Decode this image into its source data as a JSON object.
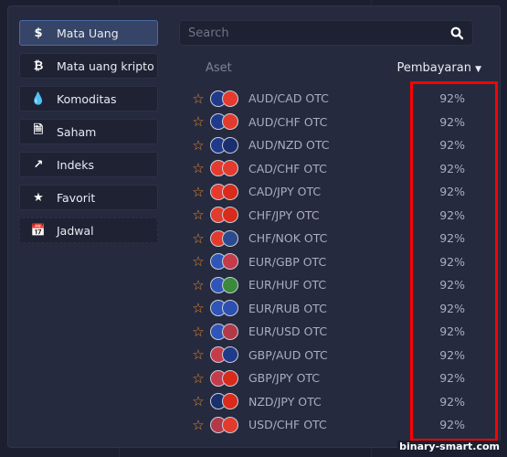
{
  "sidebar": {
    "items": [
      {
        "label": "Mata Uang",
        "icon": "dollar-icon",
        "glyph": "$",
        "active": true
      },
      {
        "label": "Mata uang kripto",
        "icon": "bitcoin-icon",
        "glyph": "₿"
      },
      {
        "label": "Komoditas",
        "icon": "drop-icon",
        "glyph": "💧"
      },
      {
        "label": "Saham",
        "icon": "document-icon",
        "glyph": "🗎"
      },
      {
        "label": "Indeks",
        "icon": "trend-up-icon",
        "glyph": "↗"
      },
      {
        "label": "Favorit",
        "icon": "star-icon",
        "glyph": "★"
      },
      {
        "label": "Jadwal",
        "icon": "calendar-icon",
        "glyph": "📅"
      }
    ]
  },
  "search": {
    "placeholder": "Search"
  },
  "header": {
    "asset": "Aset",
    "payout": "Pembayaran"
  },
  "flag_colors": {
    "AUD": "#1f3a8a",
    "CAD": "#e63a2e",
    "CHF": "#e23b2e",
    "NZD": "#1a2f6e",
    "JPY": "#d92b1c",
    "NOK": "#2c4a8e",
    "EUR": "#2f55b8",
    "GBP": "#c63b4a",
    "HUF": "#3a8a3a",
    "RUB": "#2d4fb0",
    "USD": "#b23a48"
  },
  "assets": [
    {
      "name": "AUD/CAD OTC",
      "payout": "92%"
    },
    {
      "name": "AUD/CHF OTC",
      "payout": "92%"
    },
    {
      "name": "AUD/NZD OTC",
      "payout": "92%"
    },
    {
      "name": "CAD/CHF OTC",
      "payout": "92%"
    },
    {
      "name": "CAD/JPY OTC",
      "payout": "92%"
    },
    {
      "name": "CHF/JPY OTC",
      "payout": "92%"
    },
    {
      "name": "CHF/NOK OTC",
      "payout": "92%"
    },
    {
      "name": "EUR/GBP OTC",
      "payout": "92%"
    },
    {
      "name": "EUR/HUF OTC",
      "payout": "92%"
    },
    {
      "name": "EUR/RUB OTC",
      "payout": "92%"
    },
    {
      "name": "EUR/USD OTC",
      "payout": "92%"
    },
    {
      "name": "GBP/AUD OTC",
      "payout": "92%"
    },
    {
      "name": "GBP/JPY OTC",
      "payout": "92%"
    },
    {
      "name": "NZD/JPY OTC",
      "payout": "92%"
    },
    {
      "name": "USD/CHF OTC",
      "payout": "92%"
    }
  ],
  "highlight_color": "#ff0000",
  "watermark": "binary-smart.com"
}
